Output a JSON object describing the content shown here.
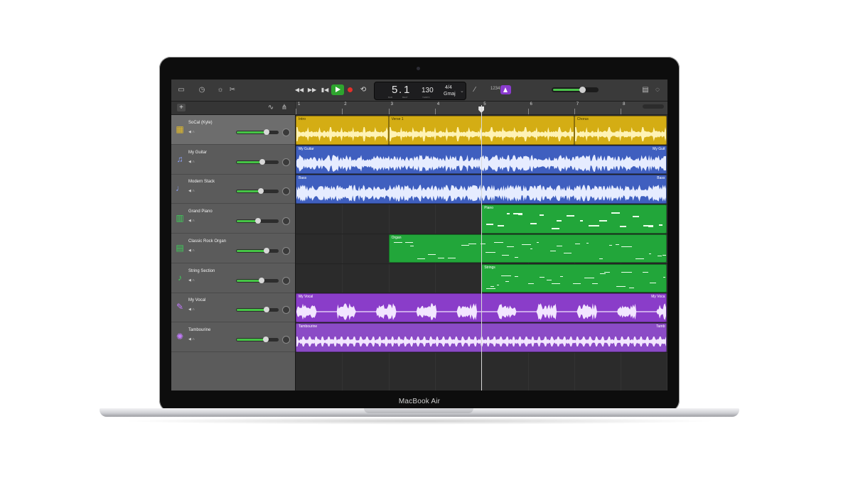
{
  "device": {
    "label": "MacBook Air"
  },
  "toolbar": {
    "lcd": {
      "bar": "5",
      "beat": "1",
      "tempo": "130",
      "signature": "4/4",
      "key": "Gmaj",
      "bar_label": "BAR",
      "beat_label": "BEAT",
      "tempo_label": "TEMPO"
    },
    "count_in": "1234",
    "master_volume": 0.66
  },
  "colors": {
    "yellow": "#d4ad14",
    "blue": "#3f5fbf",
    "green": "#22a63a",
    "purple": "#8a3dc9",
    "purple_light": "#8b4bc6",
    "wave_yellow": "#fff3b5",
    "wave_blue": "#e6ecff",
    "wave_purple": "#f2e6ff"
  },
  "ruler": {
    "bars": [
      "1",
      "2",
      "3",
      "4",
      "5",
      "6",
      "7",
      "8"
    ]
  },
  "tracks": [
    {
      "name": "SoCal (Kyle)",
      "icon": "drums-icon",
      "volume": 0.72,
      "selected": true
    },
    {
      "name": "My Guitar",
      "icon": "guitar-icon",
      "volume": 0.62,
      "selected": false
    },
    {
      "name": "Modern Stack",
      "icon": "bass-icon",
      "volume": 0.58,
      "selected": false
    },
    {
      "name": "Grand Piano",
      "icon": "piano-icon",
      "volume": 0.52,
      "selected": false
    },
    {
      "name": "Classic Rock Organ",
      "icon": "organ-icon",
      "volume": 0.72,
      "selected": false
    },
    {
      "name": "String Section",
      "icon": "strings-icon",
      "volume": 0.6,
      "selected": false
    },
    {
      "name": "My Vocal",
      "icon": "microphone-icon",
      "volume": 0.72,
      "selected": false
    },
    {
      "name": "Tambourine",
      "icon": "tambourine-icon",
      "volume": 0.7,
      "selected": false
    }
  ],
  "regions": [
    {
      "track": 0,
      "label": "Intro",
      "start": 1,
      "end": 3,
      "color": "yellow",
      "kind": "drummer"
    },
    {
      "track": 0,
      "label": "Verse 1",
      "start": 3,
      "end": 7,
      "color": "yellow",
      "kind": "drummer"
    },
    {
      "track": 0,
      "label": "Chorus",
      "start": 7,
      "end": 9,
      "color": "yellow",
      "kind": "drummer"
    },
    {
      "track": 1,
      "label": "My Guitar",
      "start": 1,
      "end": 9,
      "color": "blue",
      "kind": "audio",
      "end_label": "My Guit"
    },
    {
      "track": 2,
      "label": "Bass",
      "start": 1,
      "end": 9,
      "color": "blue",
      "kind": "audio",
      "end_label": "Bass"
    },
    {
      "track": 3,
      "label": "Piano",
      "start": 5,
      "end": 9,
      "color": "green",
      "kind": "midi"
    },
    {
      "track": 4,
      "label": "Organ",
      "start": 3,
      "end": 9,
      "color": "green",
      "kind": "midi"
    },
    {
      "track": 5,
      "label": "Strings",
      "start": 5,
      "end": 9,
      "color": "green",
      "kind": "midi"
    },
    {
      "track": 6,
      "label": "My Vocal",
      "start": 1,
      "end": 9,
      "color": "purple",
      "kind": "audio",
      "end_label": "My Voca"
    },
    {
      "track": 7,
      "label": "Tambourine",
      "start": 1,
      "end": 9,
      "color": "purple_light",
      "kind": "audio",
      "end_label": "Tamb"
    }
  ],
  "playhead_bar": 5
}
